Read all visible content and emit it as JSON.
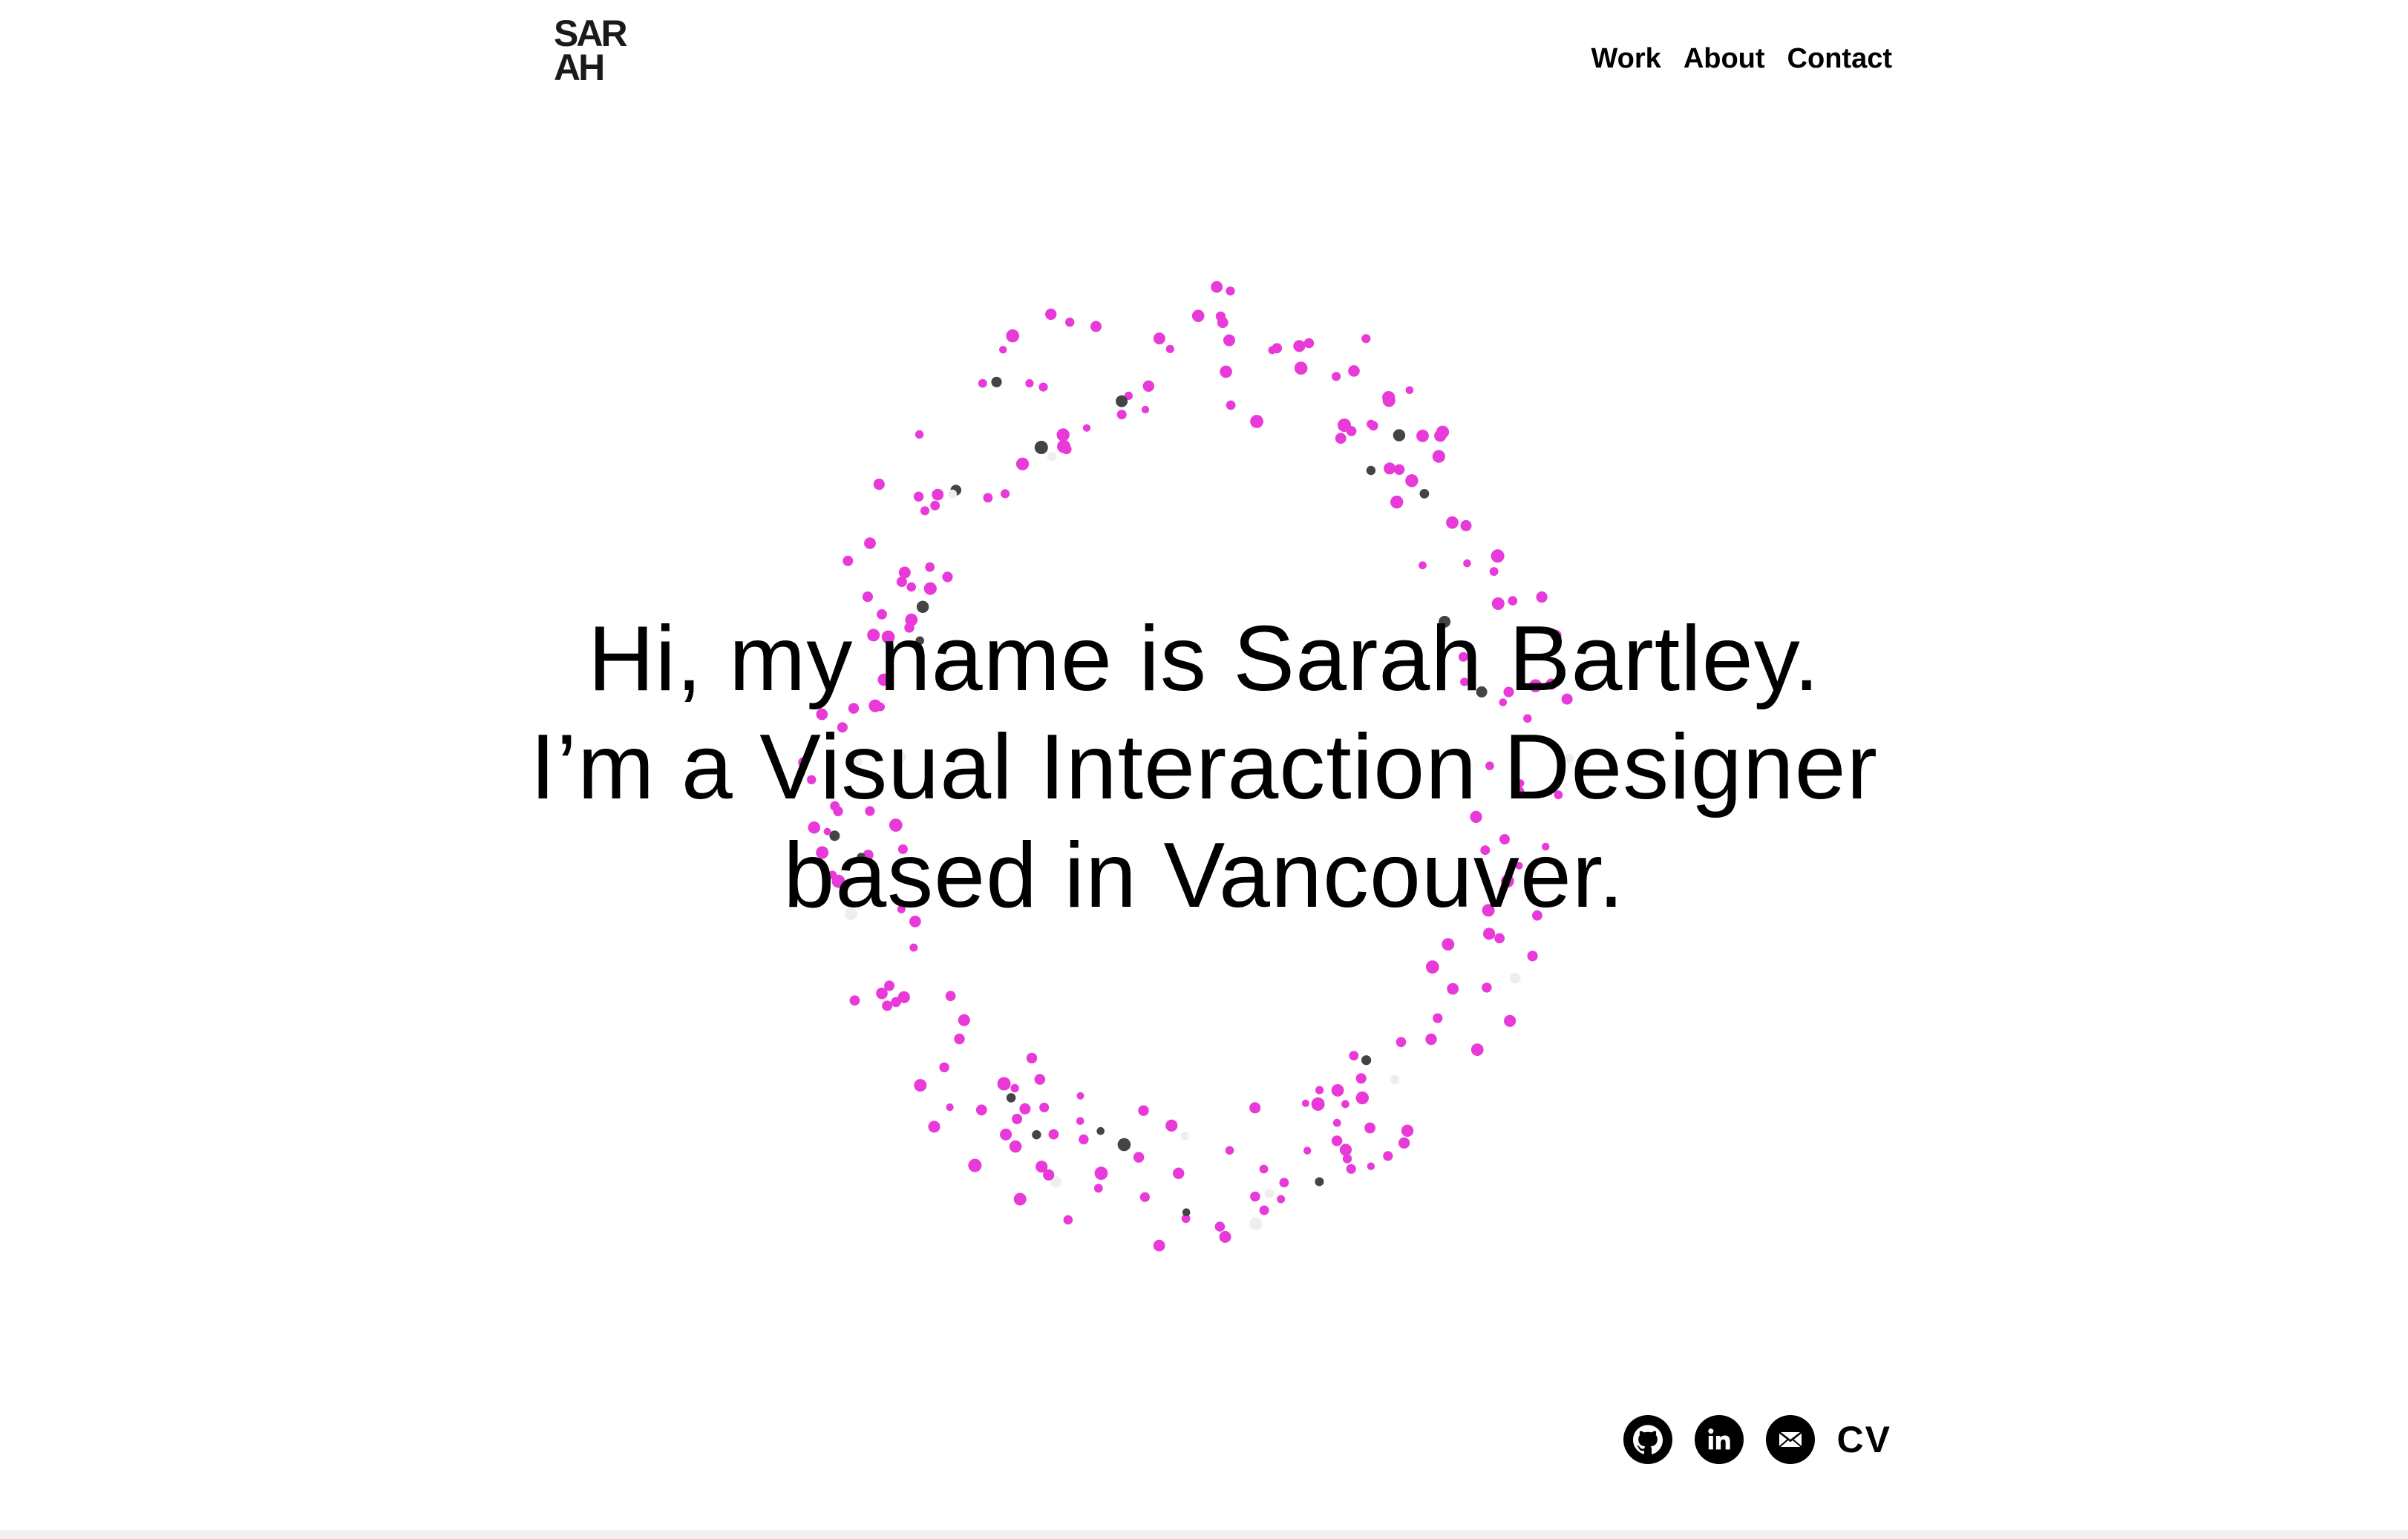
{
  "header": {
    "logo_top": "SAR",
    "logo_bottom": "AH",
    "nav": [
      "Work",
      "About",
      "Contact"
    ]
  },
  "hero": {
    "lines": [
      "Hi, my name is Sarah Bartley.",
      "I’m a Visual Interaction Designer",
      "based in Vancouver."
    ]
  },
  "footer": {
    "icons": [
      "github-icon",
      "linkedin-icon",
      "email-icon"
    ],
    "cv_label": "CV"
  },
  "colors": {
    "accent": "#e83ad8",
    "dark_dot": "#444444",
    "light_dot": "#eeeeee",
    "text": "#000000"
  }
}
